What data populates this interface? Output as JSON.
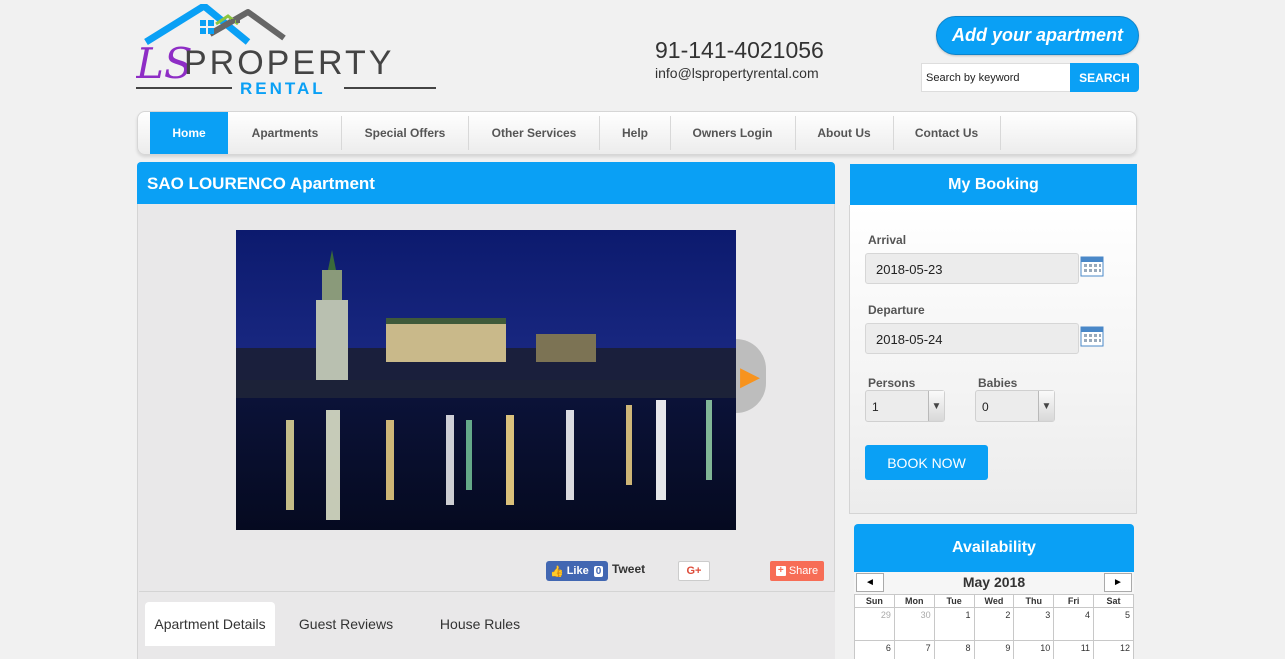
{
  "header": {
    "logo_ls": "LS",
    "logo_property": "PROPERTY",
    "logo_rental": "RENTAL",
    "phone": "91-141-4021056",
    "email": "info@lspropertyrental.com",
    "add_apartment": "Add your apartment",
    "search_value": "Search by keyword",
    "search_button": "SEARCH"
  },
  "nav": {
    "items": [
      "Home",
      "Apartments",
      "Special Offers",
      "Other Services",
      "Help",
      "Owners Login",
      "About Us",
      "Contact Us"
    ],
    "active": "Home"
  },
  "main": {
    "title": "SAO LOURENCO Apartment",
    "social": {
      "like": "Like",
      "like_count": "0",
      "tweet": "Tweet",
      "gplus": "G+",
      "share": "Share"
    },
    "tabs": [
      "Apartment Details",
      "Guest Reviews",
      "House Rules"
    ],
    "active_tab": "Apartment Details"
  },
  "booking": {
    "title": "My Booking",
    "arrival_label": "Arrival",
    "arrival_value": "2018-05-23",
    "departure_label": "Departure",
    "departure_value": "2018-05-24",
    "persons_label": "Persons",
    "persons_value": "1",
    "babies_label": "Babies",
    "babies_value": "0",
    "book_button": "BOOK NOW"
  },
  "availability": {
    "title": "Availability",
    "prev": "◄",
    "next": "►",
    "month": "May 2018",
    "weekdays": [
      "Sun",
      "Mon",
      "Tue",
      "Wed",
      "Thu",
      "Fri",
      "Sat"
    ],
    "week1": [
      "29",
      "30",
      "1",
      "2",
      "3",
      "4",
      "5"
    ],
    "week2": [
      "6",
      "7",
      "8",
      "9",
      "10",
      "11",
      "12"
    ]
  },
  "colors": {
    "accent": "#0aa0f5",
    "logo_purple": "#8e2dc5",
    "logo_gray": "#444444",
    "share": "#f76d56",
    "facebook": "#4267b2"
  }
}
